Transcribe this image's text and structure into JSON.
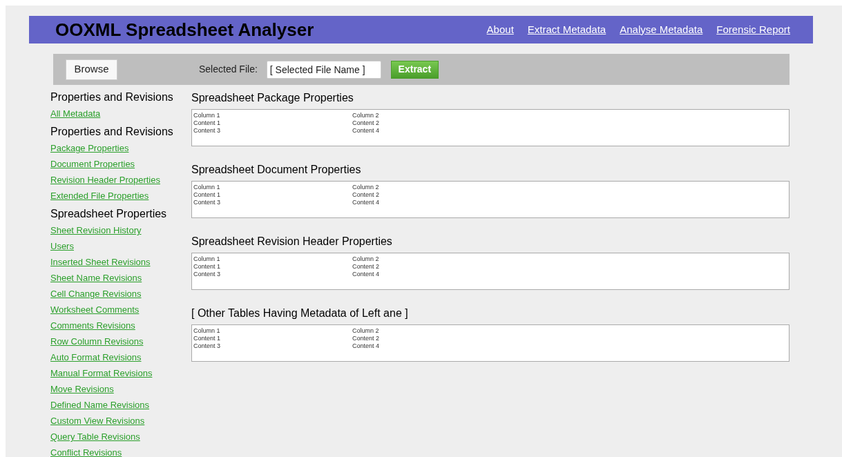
{
  "header": {
    "title": "OOXML Spreadsheet Analyser",
    "nav": [
      "About",
      "Extract Metadata",
      "Analyse Metadata",
      "Forensic Report"
    ]
  },
  "toolbar": {
    "browse": "Browse",
    "file_label": "Selected File:",
    "file_value": "[ Selected File Name ]",
    "extract": "Extract"
  },
  "sidebar": [
    {
      "heading": "Properties and Revisions",
      "links": [
        "All Metadata"
      ]
    },
    {
      "heading": "Properties and Revisions",
      "links": [
        "Package Properties",
        "Document Properties",
        "Revision Header Properties",
        "Extended File Properties"
      ]
    },
    {
      "heading": "Spreadsheet Properties",
      "links": [
        "Sheet Revision History",
        "Users",
        "Inserted Sheet Revisions",
        "Sheet Name Revisions",
        "Cell Change Revisions",
        "Worksheet Comments",
        "Comments Revisions",
        "Row Column Revisions",
        "Auto Format Revisions",
        "Manual Format Revisions",
        "Move Revisions",
        "Defined Name Revisions",
        "Custom View Revisions",
        "Query Table Revisions",
        "Conflict Revisions"
      ]
    }
  ],
  "tables": [
    {
      "title": "Spreadsheet Package Properties",
      "columns": [
        "Column 1",
        "Column 2"
      ],
      "rows": [
        [
          "Content 1",
          "Content 2"
        ],
        [
          "Content 3",
          "Content 4"
        ]
      ]
    },
    {
      "title": "Spreadsheet Document Properties",
      "columns": [
        "Column 1",
        "Column 2"
      ],
      "rows": [
        [
          "Content 1",
          "Content 2"
        ],
        [
          "Content 3",
          "Content 4"
        ]
      ]
    },
    {
      "title": "Spreadsheet Revision Header Properties",
      "columns": [
        "Column 1",
        "Column 2"
      ],
      "rows": [
        [
          "Content 1",
          "Content 2"
        ],
        [
          "Content 3",
          "Content 4"
        ]
      ]
    },
    {
      "title": "[ Other Tables Having Metadata of Left ane ]",
      "columns": [
        "Column 1",
        "Column 2"
      ],
      "rows": [
        [
          "Content 1",
          "Content 2"
        ],
        [
          "Content 3",
          "Content 4"
        ]
      ]
    }
  ]
}
